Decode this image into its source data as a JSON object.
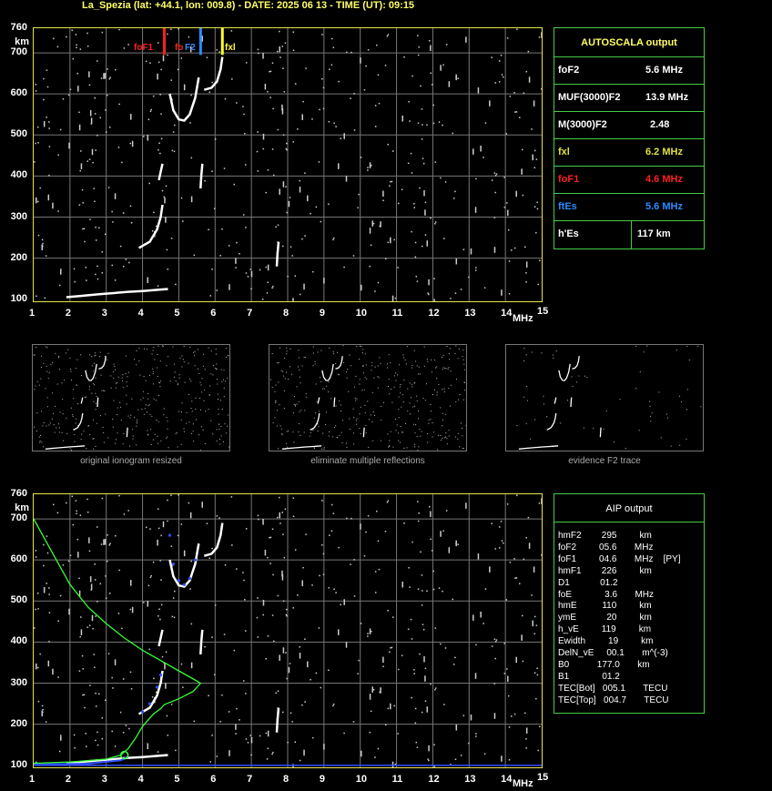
{
  "title": "La_Spezia (lat: +44.1, lon: 009.8) - DATE: 2025 06 13 - TIME (UT): 09:15",
  "axis": {
    "y_unit": "km",
    "x_unit": "MHz",
    "y_ticks": [
      "760",
      "700",
      "600",
      "500",
      "400",
      "300",
      "200",
      "100"
    ],
    "x_ticks": [
      "1",
      "2",
      "3",
      "4",
      "5",
      "6",
      "7",
      "8",
      "9",
      "10",
      "11",
      "12",
      "13",
      "14",
      "15"
    ]
  },
  "markers": {
    "foF1_label": "foF1",
    "foF2_label_a": "fo",
    "foF2_label_b": "F2",
    "fxl_label": "fxl",
    "foF1_color": "#ff2020",
    "foF2_color": "#2a8cff",
    "fxl_color": "#ffff33"
  },
  "autoscala": {
    "header": "AUTOSCALA output",
    "rows": [
      {
        "name": "foF2",
        "value": "5.6 MHz",
        "color": "#ffffff"
      },
      {
        "name": "MUF(3000)F2",
        "value": "13.9 MHz",
        "color": "#ffffff"
      },
      {
        "name": "M(3000)F2",
        "value": "2.48",
        "color": "#ffffff"
      },
      {
        "name": "fxl",
        "value": "6.2 MHz",
        "color": "#e0e040"
      },
      {
        "name": "foF1",
        "value": "4.6 MHz",
        "color": "#ff2020"
      },
      {
        "name": "ftEs",
        "value": "5.6 MHz",
        "color": "#2a8cff"
      },
      {
        "name": "h'Es",
        "value": "117     km",
        "color": "#ffffff"
      }
    ]
  },
  "thumbnails": [
    {
      "caption": "original ionogram resized"
    },
    {
      "caption": "eliminate multiple reflections"
    },
    {
      "caption": "evidence F2 trace"
    }
  ],
  "aip": {
    "header": "AIP output",
    "lines": [
      "hmF2        295         km",
      "foF2         05.6       MHz",
      "foF1         04.6       MHz    [PY]",
      "hmF1        226         km",
      "D1            01.2",
      "foE             3.6       MHz",
      "hmE          110         km",
      "ymE            20         km",
      "h_vE         119         km",
      "Ewidth         19         km",
      "DelN_vE     00.1       m^(-3)",
      "B0           177.0       km",
      "B1             01.2",
      "TEC[Bot]   005.1       TECU",
      "TEC[Top]   004.7       TECU"
    ]
  }
}
